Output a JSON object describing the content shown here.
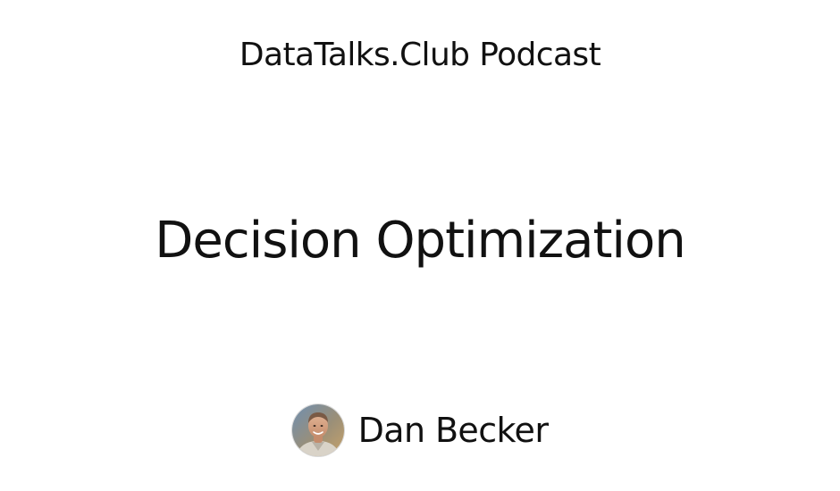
{
  "slide": {
    "podcast_name": "DataTalks.Club Podcast",
    "episode_title": "Decision Optimization",
    "guest": {
      "name": "Dan Becker",
      "avatar_icon": "person-photo-icon"
    }
  },
  "colors": {
    "background": "#ffffff",
    "text": "#111111"
  }
}
